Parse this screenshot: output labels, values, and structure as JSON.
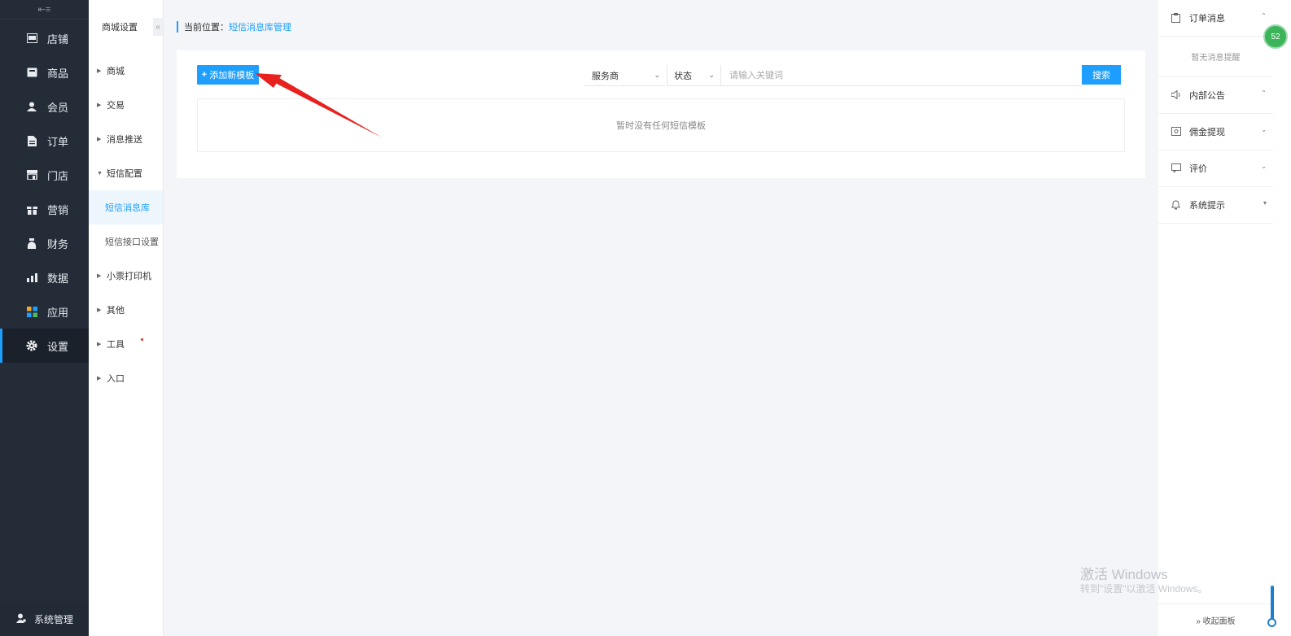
{
  "nav": {
    "collapse_icon": "list-collapse-icon",
    "items": [
      {
        "label": "店铺",
        "icon": "store-icon"
      },
      {
        "label": "商品",
        "icon": "goods-icon"
      },
      {
        "label": "会员",
        "icon": "user-icon"
      },
      {
        "label": "订单",
        "icon": "order-icon"
      },
      {
        "label": "门店",
        "icon": "shop-icon"
      },
      {
        "label": "营销",
        "icon": "gift-icon"
      },
      {
        "label": "财务",
        "icon": "money-icon"
      },
      {
        "label": "数据",
        "icon": "chart-icon"
      },
      {
        "label": "应用",
        "icon": "apps-icon"
      },
      {
        "label": "设置",
        "icon": "gear-icon"
      }
    ],
    "active": "设置",
    "bottom_label": "系统管理"
  },
  "subnav": {
    "title": "商城设置",
    "fold_icon": "«",
    "groups": [
      {
        "label": "商城"
      },
      {
        "label": "交易"
      },
      {
        "label": "消息推送"
      },
      {
        "label": "短信配置",
        "expanded": true,
        "children": [
          "短信消息库",
          "短信接口设置"
        ]
      },
      {
        "label": "小票打印机"
      },
      {
        "label": "其他"
      },
      {
        "label": "工具"
      },
      {
        "label": "入口"
      }
    ],
    "active_child": "短信消息库"
  },
  "breadcrumb": {
    "prefix": "当前位置：",
    "current": "短信消息库管理"
  },
  "toolbar": {
    "add_label": "添加新模板",
    "filter1": "服务商",
    "filter2": "状态",
    "search_placeholder": "请输入关键词",
    "search_label": "搜索"
  },
  "empty_text": "暂时没有任何短信模板",
  "right_panel": {
    "sections": [
      {
        "label": "订单消息",
        "icon": "clipboard-icon"
      },
      {
        "label": "内部公告",
        "icon": "speaker-icon"
      },
      {
        "label": "佣金提现",
        "icon": "withdraw-icon"
      },
      {
        "label": "评价",
        "icon": "comment-icon"
      },
      {
        "label": "系统提示",
        "icon": "bell-icon"
      }
    ],
    "empty_msg": "暂无消息提醒",
    "footer": "» 收起面板"
  },
  "badge_text": "52",
  "watermark": {
    "line1": "激活 Windows",
    "line2": "转到\"设置\"以激活 Windows。"
  },
  "colors": {
    "accent": "#1e9fff",
    "sidebar": "#242c38",
    "annotation": "#e8211e"
  }
}
